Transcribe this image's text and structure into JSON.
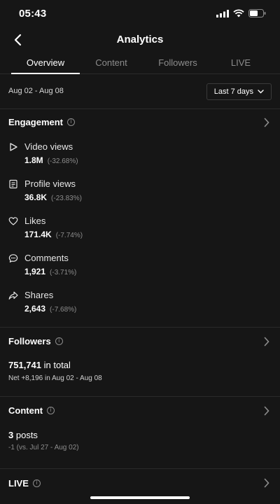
{
  "status": {
    "time": "05:43"
  },
  "header": {
    "title": "Analytics"
  },
  "tabs": [
    {
      "label": "Overview"
    },
    {
      "label": "Content"
    },
    {
      "label": "Followers"
    },
    {
      "label": "LIVE"
    }
  ],
  "date_range": "Aug 02 - Aug 08",
  "period": {
    "label": "Last 7 days"
  },
  "engagement": {
    "title": "Engagement",
    "metrics": [
      {
        "icon": "play-icon",
        "label": "Video views",
        "value": "1.8M",
        "change": "(-32.68%)"
      },
      {
        "icon": "profile-card-icon",
        "label": "Profile views",
        "value": "36.8K",
        "change": "(-23.83%)"
      },
      {
        "icon": "heart-icon",
        "label": "Likes",
        "value": "171.4K",
        "change": "(-7.74%)"
      },
      {
        "icon": "comment-icon",
        "label": "Comments",
        "value": "1,921",
        "change": "(-3.71%)"
      },
      {
        "icon": "share-icon",
        "label": "Shares",
        "value": "2,643",
        "change": "(-7.68%)"
      }
    ]
  },
  "followers": {
    "title": "Followers",
    "total": "751,741",
    "total_suffix": "in total",
    "net": "Net +8,196 in Aug 02 - Aug 08"
  },
  "content": {
    "title": "Content",
    "count": "3",
    "count_suffix": "posts",
    "change": "-1 (vs. Jul 27 - Aug 02)"
  },
  "live": {
    "title": "LIVE"
  },
  "colors": {
    "background": "#161616",
    "text": "#ffffff",
    "muted": "#8c8c8c",
    "divider": "#2a2a2a"
  }
}
